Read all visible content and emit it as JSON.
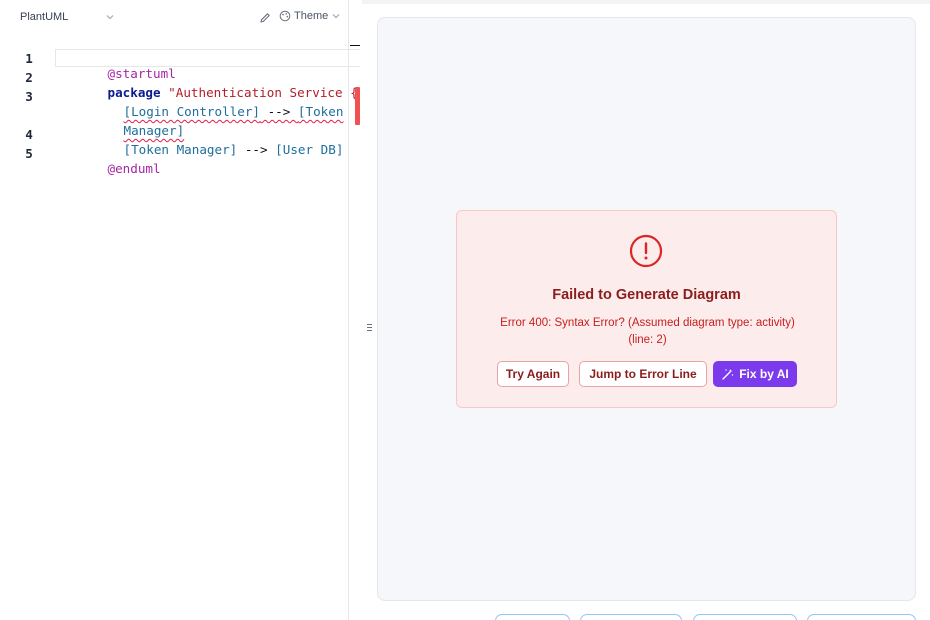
{
  "editor": {
    "language": "PlantUML",
    "theme_label": "Theme",
    "lines": [
      {
        "num": "1"
      },
      {
        "num": "2"
      },
      {
        "num": "3"
      },
      {
        "num": "4"
      },
      {
        "num": "5"
      }
    ],
    "code": {
      "l1": "@startuml",
      "l2_kw": "package",
      "l2_str": "\"Authentication Service {",
      "l3_a": "[Login Controller]",
      "l3_arrow": " --> ",
      "l3_b": "[Token",
      "l3_wrap": "Manager]",
      "l4_a": "[Token Manager]",
      "l4_arrow": " --> ",
      "l4_b": "[User DB]",
      "l5": "@enduml"
    }
  },
  "preview": {
    "error": {
      "title": "Failed to Generate Diagram",
      "message_line1": "Error 400: Syntax Error? (Assumed diagram type: activity)",
      "message_line2": "(line: 2)",
      "try_again": "Try Again",
      "jump_to_error": "Jump to Error Line",
      "fix_by_ai": "Fix by AI"
    }
  },
  "colors": {
    "error_red": "#c81e1e",
    "accent_purple": "#7c3aed",
    "error_bg": "#fdecec"
  }
}
